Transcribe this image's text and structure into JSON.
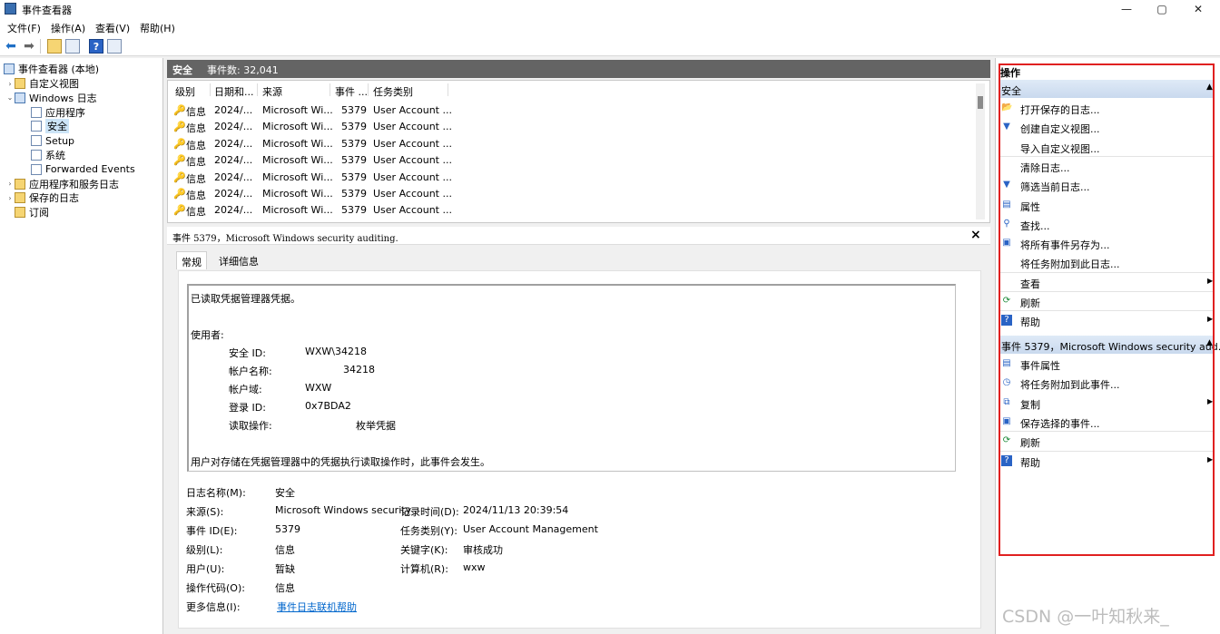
{
  "window": {
    "title": "事件查看器",
    "controls": [
      "—",
      "▢",
      "✕"
    ]
  },
  "menu": [
    "文件(F)",
    "操作(A)",
    "查看(V)",
    "帮助(H)"
  ],
  "tree": {
    "root": "事件查看器 (本地)",
    "items": [
      {
        "label": "自定义视图",
        "level": 1,
        "caret": "›"
      },
      {
        "label": "Windows 日志",
        "level": 1,
        "caret": "⌄"
      },
      {
        "label": "应用程序",
        "level": 2,
        "caret": ""
      },
      {
        "label": "安全",
        "level": 2,
        "caret": "",
        "selected": true
      },
      {
        "label": "Setup",
        "level": 2,
        "caret": ""
      },
      {
        "label": "系统",
        "level": 2,
        "caret": ""
      },
      {
        "label": "Forwarded Events",
        "level": 2,
        "caret": ""
      },
      {
        "label": "应用程序和服务日志",
        "level": 1,
        "caret": "›"
      },
      {
        "label": "保存的日志",
        "level": 1,
        "caret": "›"
      },
      {
        "label": "订阅",
        "level": 1,
        "caret": ""
      }
    ]
  },
  "list": {
    "title": "安全",
    "count": "事件数: 32,041",
    "columns": [
      "级别",
      "日期和...",
      "来源",
      "事件 ...",
      "任务类别"
    ],
    "rows": [
      [
        "信息",
        "2024/...",
        "Microsoft Wi...",
        "5379",
        "User Account ..."
      ],
      [
        "信息",
        "2024/...",
        "Microsoft Wi...",
        "5379",
        "User Account ..."
      ],
      [
        "信息",
        "2024/...",
        "Microsoft Wi...",
        "5379",
        "User Account ..."
      ],
      [
        "信息",
        "2024/...",
        "Microsoft Wi...",
        "5379",
        "User Account ..."
      ],
      [
        "信息",
        "2024/...",
        "Microsoft Wi...",
        "5379",
        "User Account ..."
      ],
      [
        "信息",
        "2024/...",
        "Microsoft Wi...",
        "5379",
        "User Account ..."
      ],
      [
        "信息",
        "2024/...",
        "Microsoft Wi...",
        "5379",
        "User Account ..."
      ]
    ]
  },
  "detail": {
    "header": "事件 5379，Microsoft Windows security auditing.",
    "tabs": [
      "常规",
      "详细信息"
    ],
    "description": {
      "line1": "已读取凭据管理器凭据。",
      "user_label": "使用者:",
      "fields": [
        {
          "k": "安全 ID:",
          "v": "WXW\\34218"
        },
        {
          "k": "帐户名称:",
          "v": "34218"
        },
        {
          "k": "帐户域:",
          "v": "WXW"
        },
        {
          "k": "登录 ID:",
          "v": "0x7BDA2"
        },
        {
          "k": "读取操作:",
          "v": "枚举凭据"
        }
      ],
      "footer": "用户对存储在凭据管理器中的凭据执行读取操作时，此事件会发生。"
    },
    "props": {
      "log_name_label": "日志名称(M):",
      "log_name": "安全",
      "source_label": "来源(S):",
      "source": "Microsoft Windows security",
      "logged_label": "记录时间(D):",
      "logged": "2024/11/13 20:39:54",
      "event_id_label": "事件 ID(E):",
      "event_id": "5379",
      "task_label": "任务类别(Y):",
      "task": "User Account Management",
      "level_label": "级别(L):",
      "level": "信息",
      "keywords_label": "关键字(K):",
      "keywords": "审核成功",
      "user_label": "用户(U):",
      "user": "暂缺",
      "computer_label": "计算机(R):",
      "computer": "wxw",
      "opcode_label": "操作代码(O):",
      "opcode": "信息",
      "more_label": "更多信息(I):",
      "more_link": "事件日志联机帮助"
    }
  },
  "actions": {
    "title": "操作",
    "section1": "安全",
    "items1": [
      {
        "label": "打开保存的日志...",
        "icon": "folder-icon",
        "glyph": "📂",
        "arrow": false
      },
      {
        "label": "创建自定义视图...",
        "icon": "filter-icon",
        "glyph": "▼",
        "arrow": false
      },
      {
        "label": "导入自定义视图...",
        "icon": "",
        "glyph": "",
        "arrow": false
      },
      {
        "label": "清除日志...",
        "icon": "",
        "glyph": "",
        "arrow": false
      },
      {
        "label": "筛选当前日志...",
        "icon": "filter-icon",
        "glyph": "▼",
        "arrow": false
      },
      {
        "label": "属性",
        "icon": "properties-icon",
        "glyph": "▤",
        "arrow": false
      },
      {
        "label": "查找...",
        "icon": "binoculars-icon",
        "glyph": "⚲",
        "arrow": false
      },
      {
        "label": "将所有事件另存为...",
        "icon": "save-icon",
        "glyph": "▣",
        "arrow": false
      },
      {
        "label": "将任务附加到此日志...",
        "icon": "",
        "glyph": "",
        "arrow": false
      },
      {
        "label": "查看",
        "icon": "",
        "glyph": "",
        "arrow": true
      },
      {
        "label": "刷新",
        "icon": "refresh-icon",
        "glyph": "⟳",
        "arrow": false
      },
      {
        "label": "帮助",
        "icon": "help-icon",
        "glyph": "?",
        "arrow": true
      }
    ],
    "section2": "事件 5379，Microsoft Windows security aud...",
    "items2": [
      {
        "label": "事件属性",
        "icon": "properties-icon",
        "glyph": "▤",
        "arrow": false
      },
      {
        "label": "将任务附加到此事件...",
        "icon": "task-icon",
        "glyph": "◷",
        "arrow": false
      },
      {
        "label": "复制",
        "icon": "copy-icon",
        "glyph": "⧉",
        "arrow": true
      },
      {
        "label": "保存选择的事件...",
        "icon": "save-icon",
        "glyph": "▣",
        "arrow": false
      },
      {
        "label": "刷新",
        "icon": "refresh-icon",
        "glyph": "⟳",
        "arrow": false
      },
      {
        "label": "帮助",
        "icon": "help-icon",
        "glyph": "?",
        "arrow": true
      }
    ]
  },
  "watermark": "CSDN @一叶知秋来_"
}
